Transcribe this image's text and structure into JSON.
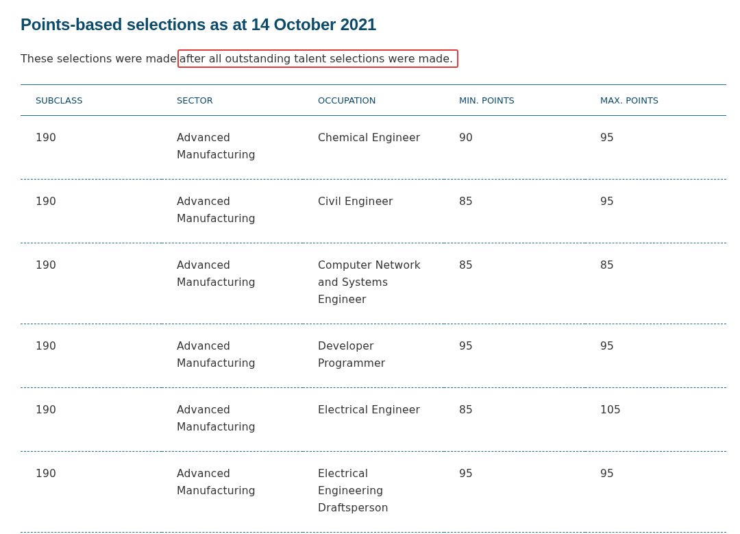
{
  "title": "Points-based selections as at 14 October 2021",
  "intro": {
    "text": "These selections were made",
    "highlighted": "after all outstanding talent selections were made."
  },
  "table": {
    "columns": [
      "SUBCLASS",
      "SECTOR",
      "OCCUPATION",
      "MIN. POINTS",
      "MAX. POINTS"
    ],
    "rows": [
      [
        "190",
        "Advanced Manufacturing",
        "Chemical Engineer",
        "90",
        "95"
      ],
      [
        "190",
        "Advanced Manufacturing",
        "Civil Engineer",
        "85",
        "95"
      ],
      [
        "190",
        "Advanced Manufacturing",
        "Computer Network and Systems Engineer",
        "85",
        "85"
      ],
      [
        "190",
        "Advanced Manufacturing",
        "Developer Programmer",
        "95",
        "95"
      ],
      [
        "190",
        "Advanced Manufacturing",
        "Electrical Engineer",
        "85",
        "105"
      ],
      [
        "190",
        "Advanced Manufacturing",
        "Electrical Engineering Draftsperson",
        "95",
        "95"
      ]
    ]
  }
}
